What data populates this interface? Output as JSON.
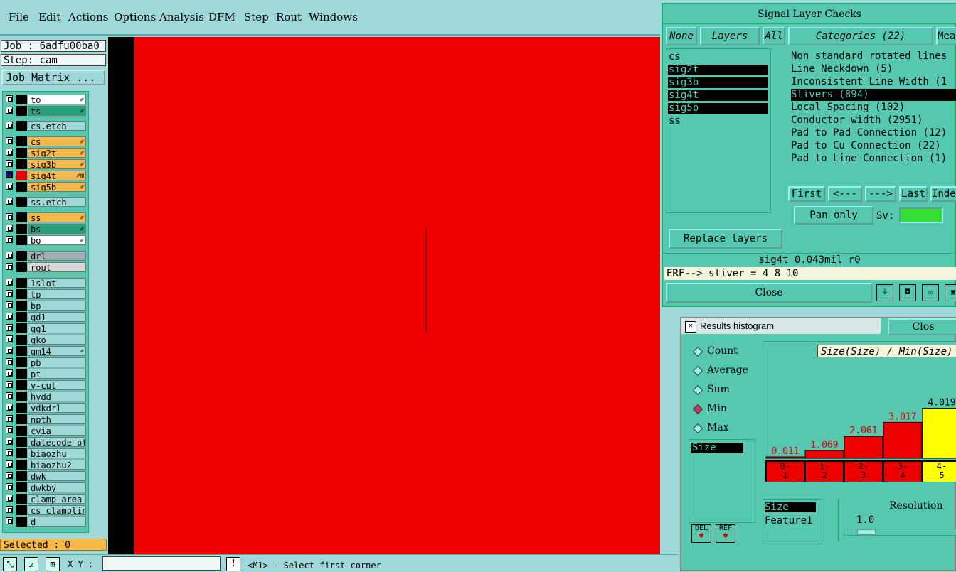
{
  "menu": [
    "File",
    "Edit",
    "Actions",
    "Options",
    "Analysis",
    "DFM",
    "Step",
    "Rout",
    "Windows"
  ],
  "job_label": "Job : 6adfu00ba0",
  "step_label": "Step: cam",
  "job_matrix_button": "Job Matrix ...",
  "layers": [
    {
      "name": "to",
      "color": "#ffffff",
      "flag": "✐"
    },
    {
      "name": "ts",
      "color": "#2aa07a",
      "flag": "✐"
    },
    {
      "name": "cs.etch",
      "color": "#9fd8d8",
      "flag": ""
    },
    {
      "name": "cs",
      "color": "#f5b84a",
      "flag": "✐"
    },
    {
      "name": "sig2t",
      "color": "#f5b84a",
      "flag": "✐"
    },
    {
      "name": "sig3b",
      "color": "#f5b84a",
      "flag": "✐"
    },
    {
      "name": "sig4t",
      "color": "#f5b84a",
      "flag": "✐⊞"
    },
    {
      "name": "sig5b",
      "color": "#f5b84a",
      "flag": "✐"
    },
    {
      "name": "ss.etch",
      "color": "#9fd8d8",
      "flag": ""
    },
    {
      "name": "ss",
      "color": "#f5b84a",
      "flag": "✐"
    },
    {
      "name": "bs",
      "color": "#2aa07a",
      "flag": "✐"
    },
    {
      "name": "bo",
      "color": "#ffffff",
      "flag": "✐"
    },
    {
      "name": "drl",
      "color": "#a0b0b8",
      "flag": ""
    },
    {
      "name": "rout",
      "color": "#d8d8d8",
      "flag": ""
    },
    {
      "name": "1slot",
      "color": "#9fd8d8",
      "flag": ""
    },
    {
      "name": "tp",
      "color": "#9fd8d8",
      "flag": ""
    },
    {
      "name": "bp",
      "color": "#9fd8d8",
      "flag": ""
    },
    {
      "name": "gd1",
      "color": "#9fd8d8",
      "flag": ""
    },
    {
      "name": "gg1",
      "color": "#9fd8d8",
      "flag": ""
    },
    {
      "name": "gko",
      "color": "#9fd8d8",
      "flag": ""
    },
    {
      "name": "gm14",
      "color": "#9fd8d8",
      "flag": "✐"
    },
    {
      "name": "pb",
      "color": "#9fd8d8",
      "flag": ""
    },
    {
      "name": "pt",
      "color": "#9fd8d8",
      "flag": ""
    },
    {
      "name": "v-cut",
      "color": "#9fd8d8",
      "flag": ""
    },
    {
      "name": "hydd",
      "color": "#9fd8d8",
      "flag": ""
    },
    {
      "name": "ydkdrl",
      "color": "#9fd8d8",
      "flag": ""
    },
    {
      "name": "npth",
      "color": "#9fd8d8",
      "flag": ""
    },
    {
      "name": "cvia",
      "color": "#9fd8d8",
      "flag": ""
    },
    {
      "name": "datecode-pte",
      "color": "#9fd8d8",
      "flag": ""
    },
    {
      "name": "biaozhu",
      "color": "#9fd8d8",
      "flag": ""
    },
    {
      "name": "biaozhu2",
      "color": "#9fd8d8",
      "flag": ""
    },
    {
      "name": "dwk",
      "color": "#9fd8d8",
      "flag": ""
    },
    {
      "name": "dwkby",
      "color": "#9fd8d8",
      "flag": ""
    },
    {
      "name": "clamp_area",
      "color": "#9fd8d8",
      "flag": ""
    },
    {
      "name": "cs_clampline",
      "color": "#9fd8d8",
      "flag": ""
    },
    {
      "name": "d",
      "color": "#9fd8d8",
      "flag": ""
    }
  ],
  "selected_label": "Selected : 0",
  "xy_label": "X Y :",
  "status_message": "<M1> - Select first corner",
  "signal_checks": {
    "title": "Signal Layer Checks",
    "btn_none": "None",
    "btn_layers": "Layers",
    "btn_all": "All",
    "categories_header": "Categories (22)",
    "meas_header": "Meas",
    "layer_items": [
      {
        "name": "cs",
        "selected": false
      },
      {
        "name": "sig2t",
        "selected": true
      },
      {
        "name": "sig3b",
        "selected": true
      },
      {
        "name": "sig4t",
        "selected": true
      },
      {
        "name": "sig5b",
        "selected": true
      },
      {
        "name": "ss",
        "selected": false
      }
    ],
    "categories": [
      {
        "name": "Non standard rotated lines",
        "selected": false
      },
      {
        "name": "Line Neckdown (5)",
        "selected": false
      },
      {
        "name": "Inconsistent Line Width (1",
        "selected": false
      },
      {
        "name": "Slivers (894)",
        "selected": true
      },
      {
        "name": "Local Spacing (102)",
        "selected": false
      },
      {
        "name": "Conductor width (2951)",
        "selected": false
      },
      {
        "name": "Pad to Pad Connection (12)",
        "selected": false
      },
      {
        "name": "Pad to Cu Connection (22)",
        "selected": false
      },
      {
        "name": "Pad to Line Connection (1)",
        "selected": false
      }
    ],
    "nav": [
      "First",
      "<---",
      "--->",
      "Last",
      "Inde"
    ],
    "pan_only": "Pan only",
    "sv_label": "Sv:",
    "replace_layers": "Replace layers",
    "status_line": "sig4t 0.043mil  r0",
    "erf_line": "ERF--> sliver = 4 8 10",
    "close": "Close"
  },
  "histogram": {
    "title": "Results histogram",
    "close": "Clos",
    "modes": [
      {
        "label": "Count",
        "on": false
      },
      {
        "label": "Average",
        "on": false
      },
      {
        "label": "Sum",
        "on": false
      },
      {
        "label": "Min",
        "on": true
      },
      {
        "label": "Max",
        "on": false
      }
    ],
    "size_item": "Size",
    "header_label": "Size(Size) / Min(Size)",
    "bins": [
      {
        "label": "0-\n1",
        "value": "0.011",
        "color": "#ee0000"
      },
      {
        "label": "1-\n2",
        "value": "1.069",
        "color": "#ee0000"
      },
      {
        "label": "2-\n3",
        "value": "2.061",
        "color": "#ee0000"
      },
      {
        "label": "3-\n4",
        "value": "3.017",
        "color": "#ee0000"
      },
      {
        "label": "4-\n5",
        "value": "4.019",
        "color": "#ffff00"
      }
    ],
    "bin_fill": [
      0.0,
      0.1,
      0.28,
      0.46,
      0.64
    ],
    "sf_items": [
      "Size",
      "Feature1"
    ],
    "resolution_label": "Resolution",
    "resolution_value": "1.0",
    "del_label": "DEL",
    "ref_label": "REF"
  },
  "colors": {
    "canvas": "#ee0000",
    "panel": "#9fd8d8",
    "dialog": "#56c8b0",
    "layer_color_active": "#ee0000",
    "sv_swatch": "#33e033"
  }
}
